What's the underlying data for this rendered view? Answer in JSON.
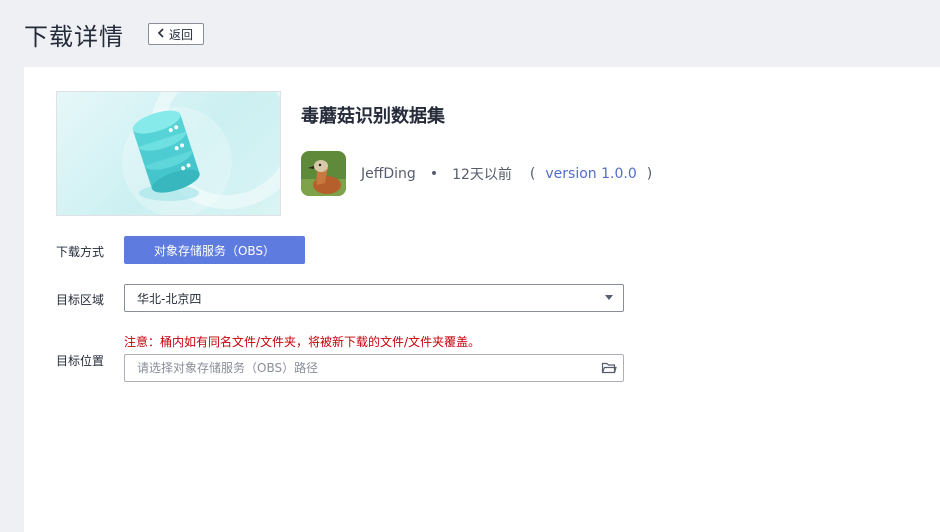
{
  "header": {
    "title": "下载详情",
    "back_label": "返回"
  },
  "dataset": {
    "title": "毒蘑菇识别数据集",
    "author": "JeffDing",
    "separator": "•",
    "time": "12天以前",
    "paren_open": "(",
    "version": "version 1.0.0",
    "paren_close": ")"
  },
  "form": {
    "download_method_label": "下载方式",
    "download_method_button": "对象存储服务（OBS）",
    "region_label": "目标区域",
    "region_value": "华北-北京四",
    "location_label": "目标位置",
    "warning": "注意：桶内如有同名文件/文件夹，将被新下载的文件/文件夹覆盖。",
    "path_placeholder": "请选择对象存储服务（OBS）路径"
  },
  "colors": {
    "primary_button": "#5e7ce0",
    "link": "#526ecc",
    "warning": "#c7000b",
    "background": "#eff0f4"
  },
  "icons": {
    "back": "chevron-left-icon",
    "select": "caret-down-icon",
    "path": "folder-open-icon",
    "cover": "database-icon"
  }
}
